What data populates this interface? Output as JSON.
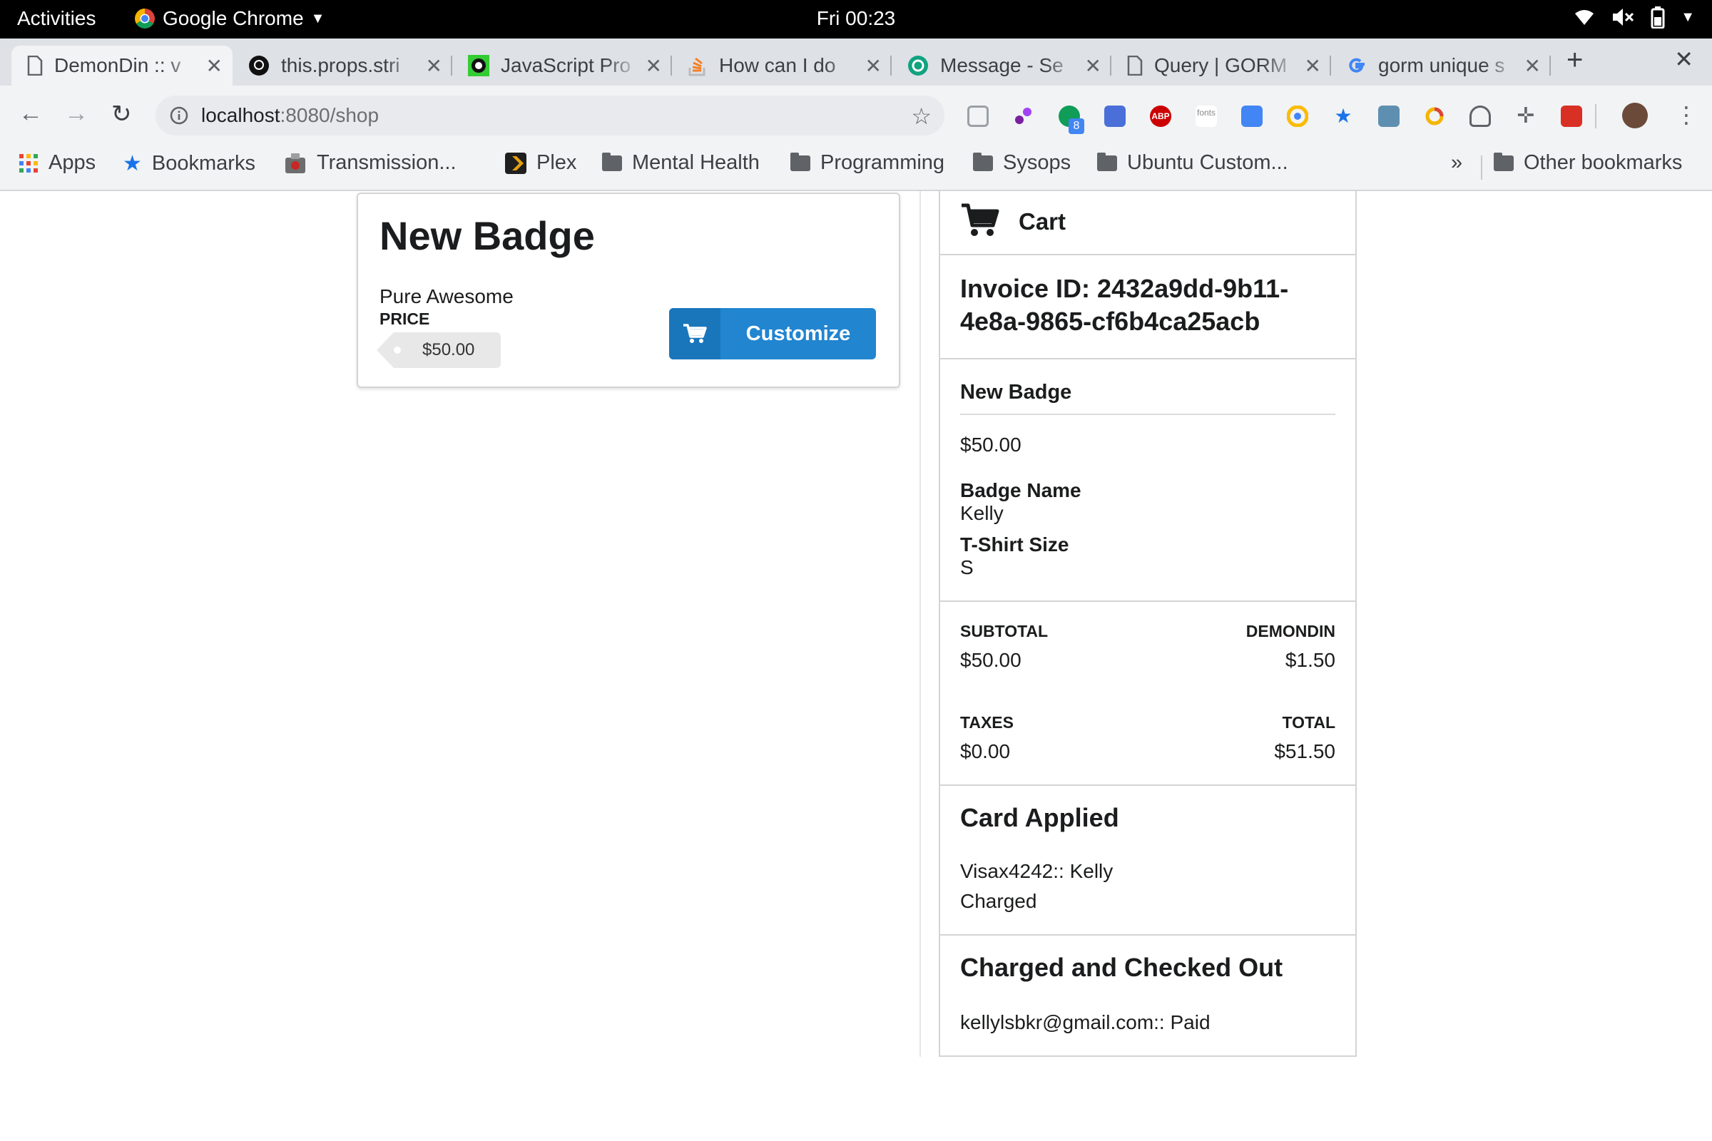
{
  "system_bar": {
    "activities": "Activities",
    "app_name": "Google Chrome",
    "clock": "Fri 00:23"
  },
  "browser": {
    "tabs": [
      {
        "title": "DemonDin :: v",
        "icon": "page-icon"
      },
      {
        "title": "this.props.stri",
        "icon": "github-icon"
      },
      {
        "title": "JavaScript Pro",
        "icon": "power-icon"
      },
      {
        "title": "How can I do",
        "icon": "stackoverflow-icon"
      },
      {
        "title": "Message - Se",
        "icon": "openai-icon"
      },
      {
        "title": "Query | GORM",
        "icon": "page-icon"
      },
      {
        "title": "gorm unique s",
        "icon": "google-icon"
      }
    ],
    "url_host": "localhost",
    "url_path": ":8080/shop",
    "bookmarks": [
      {
        "label": "Apps",
        "icon": "apps-grid-icon"
      },
      {
        "label": "Bookmarks",
        "icon": "star-icon"
      },
      {
        "label": "Transmission...",
        "icon": "transmission-icon"
      },
      {
        "label": "Plex",
        "icon": "plex-icon"
      },
      {
        "label": "Mental Health",
        "icon": "folder-icon"
      },
      {
        "label": "Programming",
        "icon": "folder-icon"
      },
      {
        "label": "Sysops",
        "icon": "folder-icon"
      },
      {
        "label": "Ubuntu Custom...",
        "icon": "folder-icon"
      }
    ],
    "overflow": "»",
    "other_bookmarks": "Other bookmarks",
    "extension_badge": "8",
    "abp_label": "ABP",
    "fonts_label": "fonts"
  },
  "product": {
    "title": "New Badge",
    "description": "Pure Awesome",
    "price_label": "PRICE",
    "price": "$50.00",
    "button_label": "Customize"
  },
  "cart": {
    "header": "Cart",
    "invoice": "Invoice ID: 2432a9dd-9b11-4e8a-9865-cf6b4ca25acb",
    "item": {
      "name": "New Badge",
      "price": "$50.00",
      "fields": [
        {
          "label": "Badge Name",
          "value": "Kelly"
        },
        {
          "label": "T-Shirt Size",
          "value": "S"
        }
      ]
    },
    "totals": {
      "subtotal_label": "SUBTOTAL",
      "subtotal": "$50.00",
      "fee_label": "DEMONDIN",
      "fee": "$1.50",
      "taxes_label": "TAXES",
      "taxes": "$0.00",
      "total_label": "TOTAL",
      "total": "$51.50"
    },
    "card": {
      "heading": "Card Applied",
      "line": "Visax4242:: Kelly",
      "status": "Charged"
    },
    "checkout": {
      "heading": "Charged and Checked Out",
      "line": "kellylsbkr@gmail.com:: Paid"
    }
  },
  "colors": {
    "primary_button": "#2185d0",
    "browser_chrome": "#dee1e6",
    "toolbar": "#f1f3f4"
  }
}
